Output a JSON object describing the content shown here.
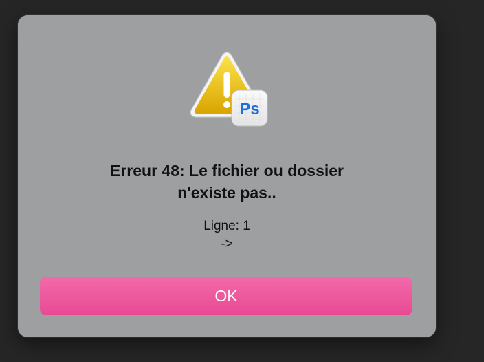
{
  "dialog": {
    "badge_text": "Ps",
    "title_line1": "Erreur 48: Le fichier ou dossier",
    "title_line2": "n'existe pas..",
    "message_line1": "Ligne: 1",
    "message_line2": "->",
    "ok_label": "OK",
    "icon": "warning-triangle-icon",
    "app_badge_icon": "photoshop-icon"
  },
  "colors": {
    "page_background": "#262626",
    "dialog_background": "#9d9fa0",
    "button_pink": "#ee5a9e",
    "warning_yellow": "#f0c419",
    "ps_blue": "#1f6fd8"
  }
}
